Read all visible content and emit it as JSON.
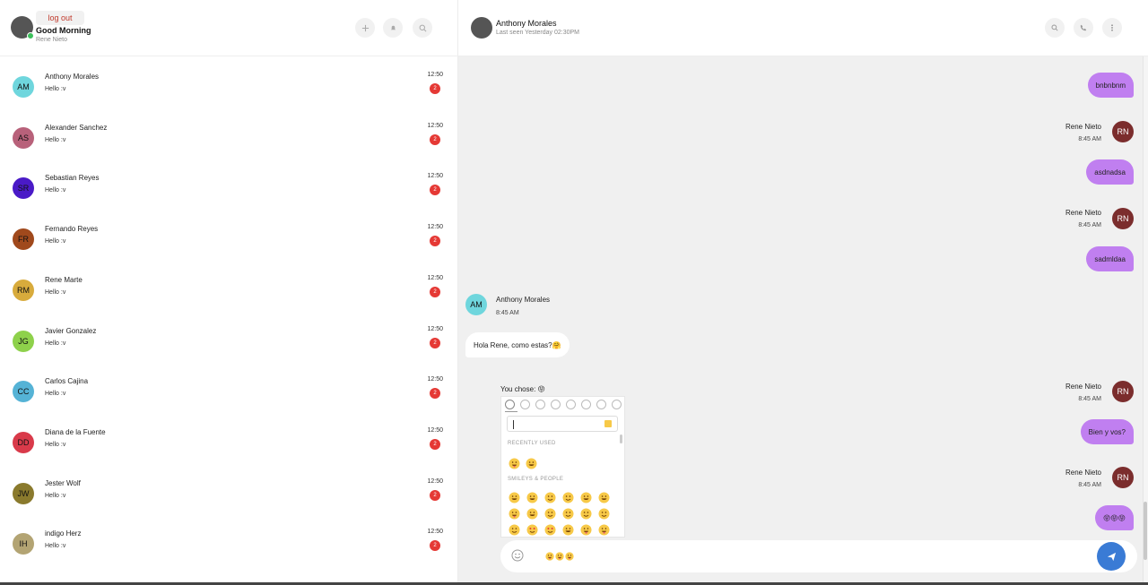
{
  "me": {
    "logout_label": "log out",
    "greeting": "Good Morning",
    "name": "Rene Nieto"
  },
  "sidebar_actions": [
    {
      "icon": "plus-icon"
    },
    {
      "icon": "bell-icon"
    },
    {
      "icon": "search-icon"
    }
  ],
  "contacts": [
    {
      "initials": "AM",
      "name": "Anthony Morales",
      "last_message": "Hello :v",
      "time": "12:50",
      "unread": "2",
      "color": "#6fd6dd"
    },
    {
      "initials": "AS",
      "name": "Alexander Sanchez",
      "last_message": "Hello :v",
      "time": "12:50",
      "unread": "2",
      "color": "#b8617a"
    },
    {
      "initials": "SR",
      "name": "Sebastian Reyes",
      "last_message": "Hello :v",
      "time": "12:50",
      "unread": "2",
      "color": "#4a1ac7"
    },
    {
      "initials": "FR",
      "name": "Fernando Reyes",
      "last_message": "Hello :v",
      "time": "12:50",
      "unread": "2",
      "color": "#a0491c"
    },
    {
      "initials": "RM",
      "name": "Rene Marte",
      "last_message": "Hello :v",
      "time": "12:50",
      "unread": "2",
      "color": "#d8ab3c"
    },
    {
      "initials": "JG",
      "name": "Javier Gonzalez",
      "last_message": "Hello :v",
      "time": "12:50",
      "unread": "2",
      "color": "#8ed14b"
    },
    {
      "initials": "CC",
      "name": "Carlos Cajina",
      "last_message": "Hello :v",
      "time": "12:50",
      "unread": "2",
      "color": "#55b3d6"
    },
    {
      "initials": "DD",
      "name": "Diana de la Fuente",
      "last_message": "Hello :v",
      "time": "12:50",
      "unread": "2",
      "color": "#d93a4a"
    },
    {
      "initials": "JW",
      "name": "Jester Wolf",
      "last_message": "Hello :v",
      "time": "12:50",
      "unread": "2",
      "color": "#8a7a2d"
    },
    {
      "initials": "IH",
      "name": "indigo Herz",
      "last_message": "Hello :v",
      "time": "12:50",
      "unread": "2",
      "color": "#b3a473"
    }
  ],
  "chat": {
    "peer_name": "Anthony Morales",
    "peer_status": "Last seen Yesterday 02:30PM",
    "header_actions": [
      {
        "icon": "search-icon"
      },
      {
        "icon": "phone-icon"
      },
      {
        "icon": "more-vertical-icon"
      }
    ],
    "messages": [
      {
        "kind": "out-bubble",
        "text": "bnbnbnm"
      },
      {
        "kind": "out-meta",
        "sender": "Rene Nieto",
        "time": "8:45 AM",
        "initials": "RN"
      },
      {
        "kind": "out-bubble",
        "text": "asdnadsa"
      },
      {
        "kind": "out-meta",
        "sender": "Rene Nieto",
        "time": "8:45 AM",
        "initials": "RN"
      },
      {
        "kind": "out-bubble",
        "text": "sadmldaa"
      },
      {
        "kind": "in-meta",
        "sender": "Anthony Morales",
        "time": "8:45 AM",
        "initials": "AM"
      },
      {
        "kind": "in-bubble",
        "text": "Hola Rene, como estas?🤗"
      },
      {
        "kind": "out-meta",
        "sender": "Rene Nieto",
        "time": "8:45 AM",
        "initials": "RN"
      },
      {
        "kind": "out-bubble",
        "text": "Bien y vos?"
      },
      {
        "kind": "out-meta",
        "sender": "Rene Nieto",
        "time": "8:45 AM",
        "initials": "RN"
      },
      {
        "kind": "out-bubble",
        "text": "😝😝😝"
      }
    ],
    "you_chose": "You chose: 😝"
  },
  "emoji_picker": {
    "recently_used_title": "RECENTLY USED",
    "smileys_title": "SMILEYS & PEOPLE",
    "categories": [
      "clock-icon",
      "smiley-icon",
      "bear-icon",
      "food-icon",
      "ball-icon",
      "travel-icon",
      "bulb-icon",
      "flag-icon"
    ]
  },
  "composer": {
    "text": "😝😝😝",
    "emoji_button_icon": "smile-icon",
    "send_icon": "send-icon"
  },
  "colors": {
    "outgoing_bubble": "#c07ff0",
    "send_button": "#3a7bd5",
    "unread_badge": "#e53935",
    "online_dot": "#3bbf5a"
  }
}
